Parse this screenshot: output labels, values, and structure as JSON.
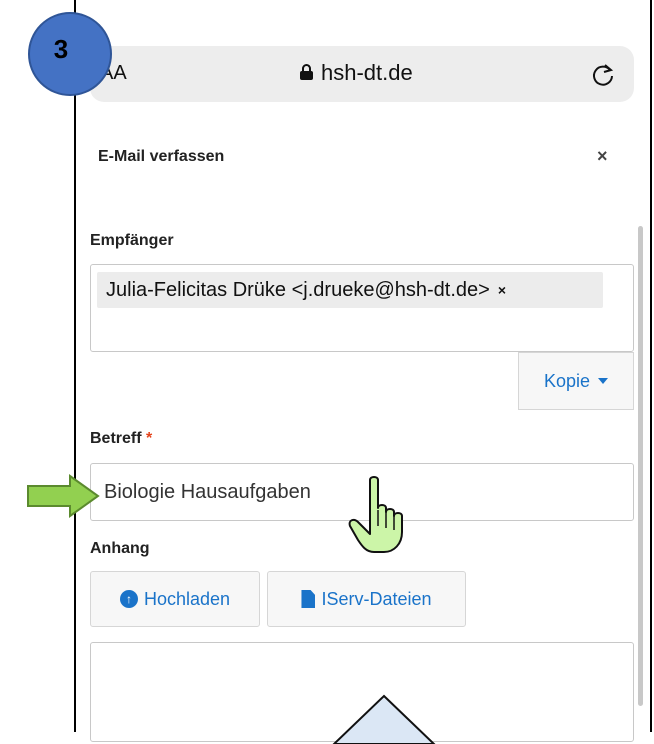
{
  "browser": {
    "text_size_label": "AA",
    "url": "hsh-dt.de",
    "lock_icon": "lock-icon",
    "reload_icon": "reload-icon"
  },
  "step_badge": {
    "number": "3",
    "color": "#4472c4"
  },
  "modal": {
    "title": "E-Mail verfassen",
    "close_symbol": "×",
    "recipients_label": "Empfänger",
    "recipients": [
      {
        "text": "Julia-Felicitas Drüke <j.drueke@hsh-dt.de>",
        "remove": "×"
      }
    ],
    "cc_button_label": "Kopie",
    "subject_label": "Betreff",
    "subject_required_mark": "*",
    "subject_value": "Biologie Hausaufgaben",
    "attachment_label": "Anhang",
    "upload_button_label": "Hochladen",
    "iserv_files_button_label": "IServ-Dateien"
  },
  "colors": {
    "accent": "#1a73c9",
    "required": "#e4431b",
    "highlight_arrow": "#92d050"
  }
}
